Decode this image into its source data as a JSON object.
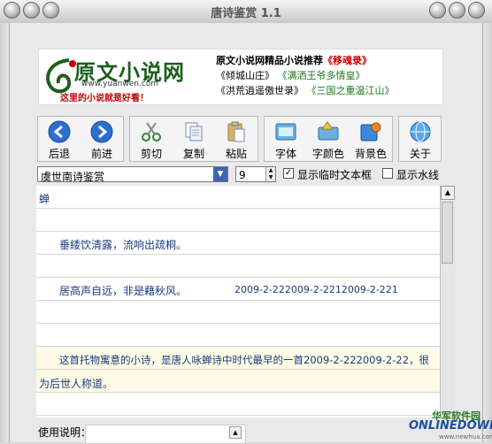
{
  "window": {
    "title": "唐诗鉴赏 1.1"
  },
  "banner": {
    "logo_text": "原文小说网",
    "logo_url": "www.yuanwen.com",
    "logo_slogan": "这里的小说就是好看！",
    "promo_title": "原文小说网精品小说推荐",
    "promo_book1": "《移魂录》",
    "promo_line2": [
      "《倾城山庄》",
      "《满洒王爷多情皇》"
    ],
    "promo_line3": [
      "《洪荒逍遥傲世录》",
      "《三国之重温江山》"
    ]
  },
  "toolbar": {
    "buttons": [
      {
        "label": "后退",
        "icon": "back-arrow-icon"
      },
      {
        "label": "前进",
        "icon": "forward-arrow-icon"
      },
      {
        "label": "剪切",
        "icon": "scissors-icon"
      },
      {
        "label": "复制",
        "icon": "copy-icon"
      },
      {
        "label": "粘贴",
        "icon": "paste-icon"
      },
      {
        "label": "字体",
        "icon": "font-icon"
      },
      {
        "label": "字颜色",
        "icon": "font-color-icon"
      },
      {
        "label": "背景色",
        "icon": "background-color-icon"
      },
      {
        "label": "关于",
        "icon": "globe-icon"
      }
    ]
  },
  "controls": {
    "poem_select": "虞世南诗鉴赏",
    "font_size": "9",
    "show_temp_textbox": "显示临时文本框",
    "show_temp_checked": true,
    "show_watermark": "显示水线",
    "show_watermark_checked": false
  },
  "document": {
    "title": "蝉",
    "line1": "垂緌饮清露，流响出疏桐。",
    "line2": "居高声自远，非是藉秋风。",
    "line2_dates": "2009-2-222009-2-2212009-2-221",
    "comment1": "这首托物寓意的小诗，是唐人咏蝉诗中时代最早的一首2009-2-222009-2-22，很",
    "comment2": "为后世人称道。"
  },
  "footer": {
    "usage_label": "使用说明：",
    "watermark_line1": "华军软件园",
    "watermark_line2": "ONLINEDOWN",
    "watermark_line3": "www.newhua.com"
  },
  "colors": {
    "accent": "#3c64b4",
    "text_blue": "#1a3c7a",
    "brand_red": "#d00000",
    "brand_green": "#1e7a1e"
  }
}
